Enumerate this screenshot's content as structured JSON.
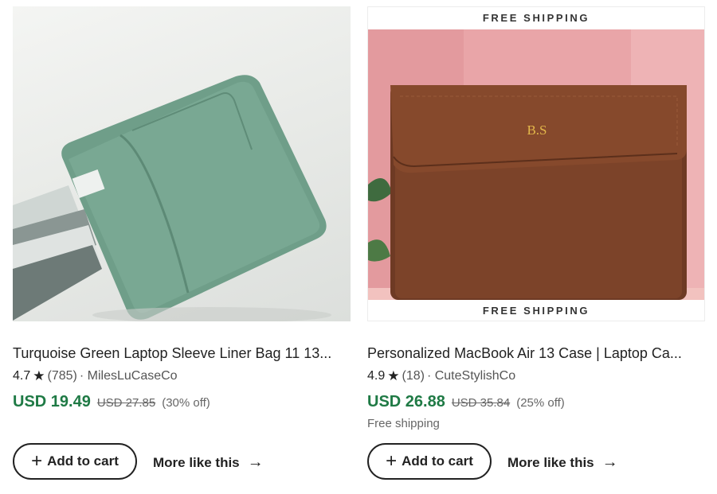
{
  "products": [
    {
      "title": "Turquoise Green Laptop Sleeve Liner Bag 11 13...",
      "rating": "4.7",
      "reviews": "(785)",
      "shop": "· MilesLuCaseCo",
      "price": "USD 19.49",
      "old_price": "USD 27.85",
      "discount": "(30% off)",
      "add_to_cart": "Add to cart",
      "more_like_this": "More like this",
      "image_icon": "green-laptop-sleeve-image"
    },
    {
      "badge_top": "FREE SHIPPING",
      "badge_bottom": "FREE SHIPPING",
      "monogram": "B.S",
      "title": "Personalized MacBook Air 13 Case | Laptop Ca...",
      "rating": "4.9",
      "reviews": "(18)",
      "shop": "· CuteStylishCo",
      "price": "USD 26.88",
      "old_price": "USD 35.84",
      "discount": "(25% off)",
      "shipping_note": "Free shipping",
      "add_to_cart": "Add to cart",
      "more_like_this": "More like this",
      "image_icon": "brown-leather-case-image"
    }
  ],
  "colors": {
    "price_green": "#1f7a45",
    "sleeve_green": "#6b9c86",
    "leather_brown": "#7a4028",
    "pink_background": "#e9a5a8"
  },
  "icons": {
    "star": "star-icon",
    "plus": "plus-icon",
    "arrow": "arrow-right-icon"
  }
}
